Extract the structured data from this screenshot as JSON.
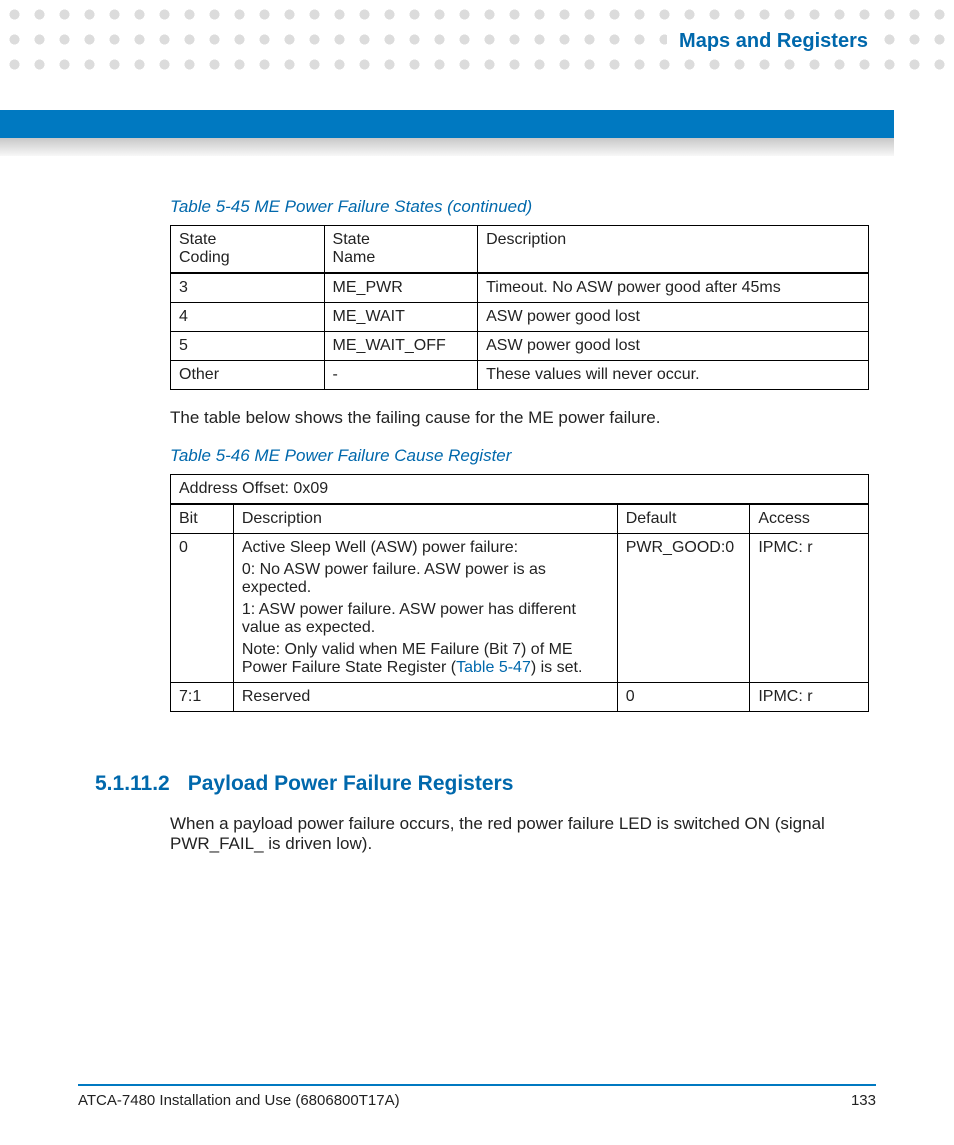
{
  "header": {
    "title": "Maps and Registers"
  },
  "table1": {
    "caption": "Table 5-45 ME Power Failure States (continued)",
    "headers": {
      "h1a": "State",
      "h1b": "Coding",
      "h2a": "State",
      "h2b": "Name",
      "h3": "Description"
    },
    "rows": [
      {
        "coding": "3",
        "name": "ME_PWR",
        "desc": "Timeout. No ASW power good after 45ms"
      },
      {
        "coding": "4",
        "name": "ME_WAIT",
        "desc": "ASW power good lost"
      },
      {
        "coding": "5",
        "name": "ME_WAIT_OFF",
        "desc": "ASW power good lost"
      },
      {
        "coding": "Other",
        "name": "-",
        "desc": "These values will never occur."
      }
    ]
  },
  "para1": "The table below shows the failing cause for the ME power failure.",
  "table2": {
    "caption": "Table 5-46 ME Power Failure Cause Register",
    "address": "Address Offset: 0x09",
    "headers": {
      "h1": "Bit",
      "h2": "Description",
      "h3": "Default",
      "h4": "Access"
    },
    "row0": {
      "bit": "0",
      "d1": "Active Sleep Well (ASW) power failure:",
      "d2": "0: No ASW power failure. ASW power is as expected.",
      "d3": "1: ASW power failure. ASW power has different value as expected.",
      "d4a": "Note: Only valid when ME Failure (Bit 7) of ME Power Failure State Register (",
      "d4link": "Table 5-47",
      "d4b": ") is set.",
      "default": "PWR_GOOD:0",
      "access": "IPMC: r"
    },
    "row1": {
      "bit": "7:1",
      "desc": "Reserved",
      "default": "0",
      "access": "IPMC: r"
    }
  },
  "section": {
    "num": "5.1.11.2",
    "title": "Payload Power Failure Registers"
  },
  "para2": "When a payload power failure occurs, the red power failure LED is switched ON (signal PWR_FAIL_ is driven low).",
  "footer": {
    "doc": "ATCA-7480 Installation and Use (6806800T17A)",
    "page": "133"
  }
}
